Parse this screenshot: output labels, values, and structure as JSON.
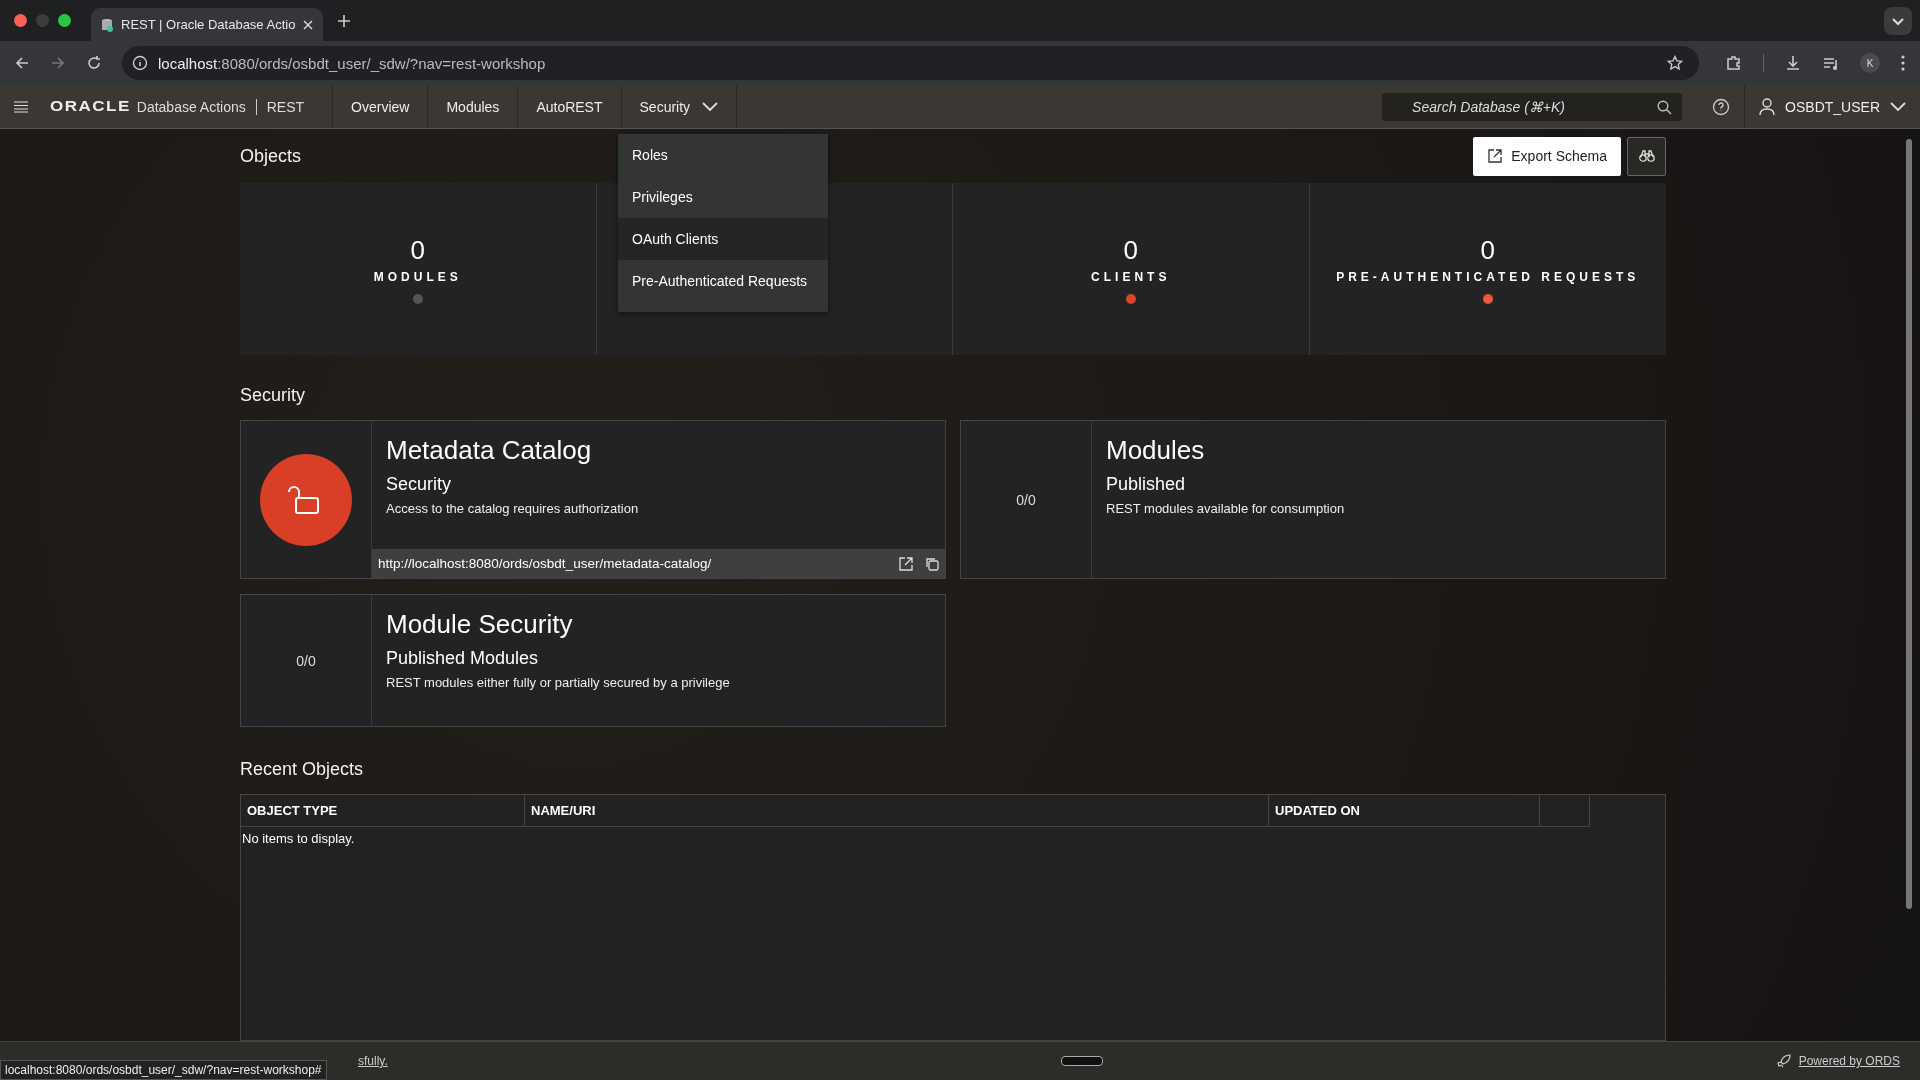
{
  "browser": {
    "tab_title": "REST | Oracle Database Actio",
    "url_host": "localhost",
    "url_rest": ":8080/ords/osbdt_user/_sdw/?nav=rest-workshop",
    "avatar": "K"
  },
  "header": {
    "logo": "ORACLE",
    "product": "Database Actions",
    "section": "REST",
    "nav": [
      {
        "label": "Overview",
        "kind": "plain"
      },
      {
        "label": "Modules",
        "kind": "plain"
      },
      {
        "label": "AutoREST",
        "kind": "plain"
      },
      {
        "label": "Security",
        "kind": "menu"
      }
    ],
    "search": {
      "placeholder": "Search Database (⌘+K)"
    },
    "user": "OSBDT_USER"
  },
  "security_menu": [
    {
      "label": "Roles",
      "selected": false
    },
    {
      "label": "Privileges",
      "selected": false
    },
    {
      "label": "OAuth Clients",
      "selected": true
    },
    {
      "label": "Pre-Authenticated Requests",
      "selected": false
    }
  ],
  "objects": {
    "title": "Objects",
    "export_button": "Export Schema",
    "cards": [
      {
        "kind": "stat",
        "count": "0",
        "label": "MODULES",
        "color": "#555555"
      },
      {
        "kind": "covered"
      },
      {
        "kind": "stat",
        "count": "0",
        "label": "CLIENTS",
        "color": "#d9442b"
      },
      {
        "kind": "stat",
        "count": "0",
        "label": "PRE-AUTHENTICATED REQUESTS",
        "color": "#e8593c"
      }
    ]
  },
  "security": {
    "title": "Security",
    "tiles": [
      {
        "kind": "lock",
        "title": "Metadata Catalog",
        "subtitle": "Security",
        "description": "Access to the catalog requires authorization",
        "link": "http://localhost:8080/ords/osbdt_user/metadata-catalog/"
      },
      {
        "kind": "count",
        "count": "0/0",
        "title": "Modules",
        "subtitle": "Published",
        "description": "REST modules available for consumption"
      },
      {
        "kind": "count",
        "count": "0/0",
        "title": "Module Security",
        "subtitle": "Published Modules",
        "description": "REST modules either fully or partially secured by a privilege"
      }
    ]
  },
  "recent": {
    "title": "Recent Objects",
    "columns": [
      "OBJECT TYPE",
      "NAME/URI",
      "UPDATED ON"
    ],
    "empty": "No items to display."
  },
  "footer": {
    "status_tail": "sfully.",
    "hover_url": "localhost:8080/ords/osbdt_user/_sdw/?nav=rest-workshop#",
    "powered": "Powered by ORDS"
  }
}
